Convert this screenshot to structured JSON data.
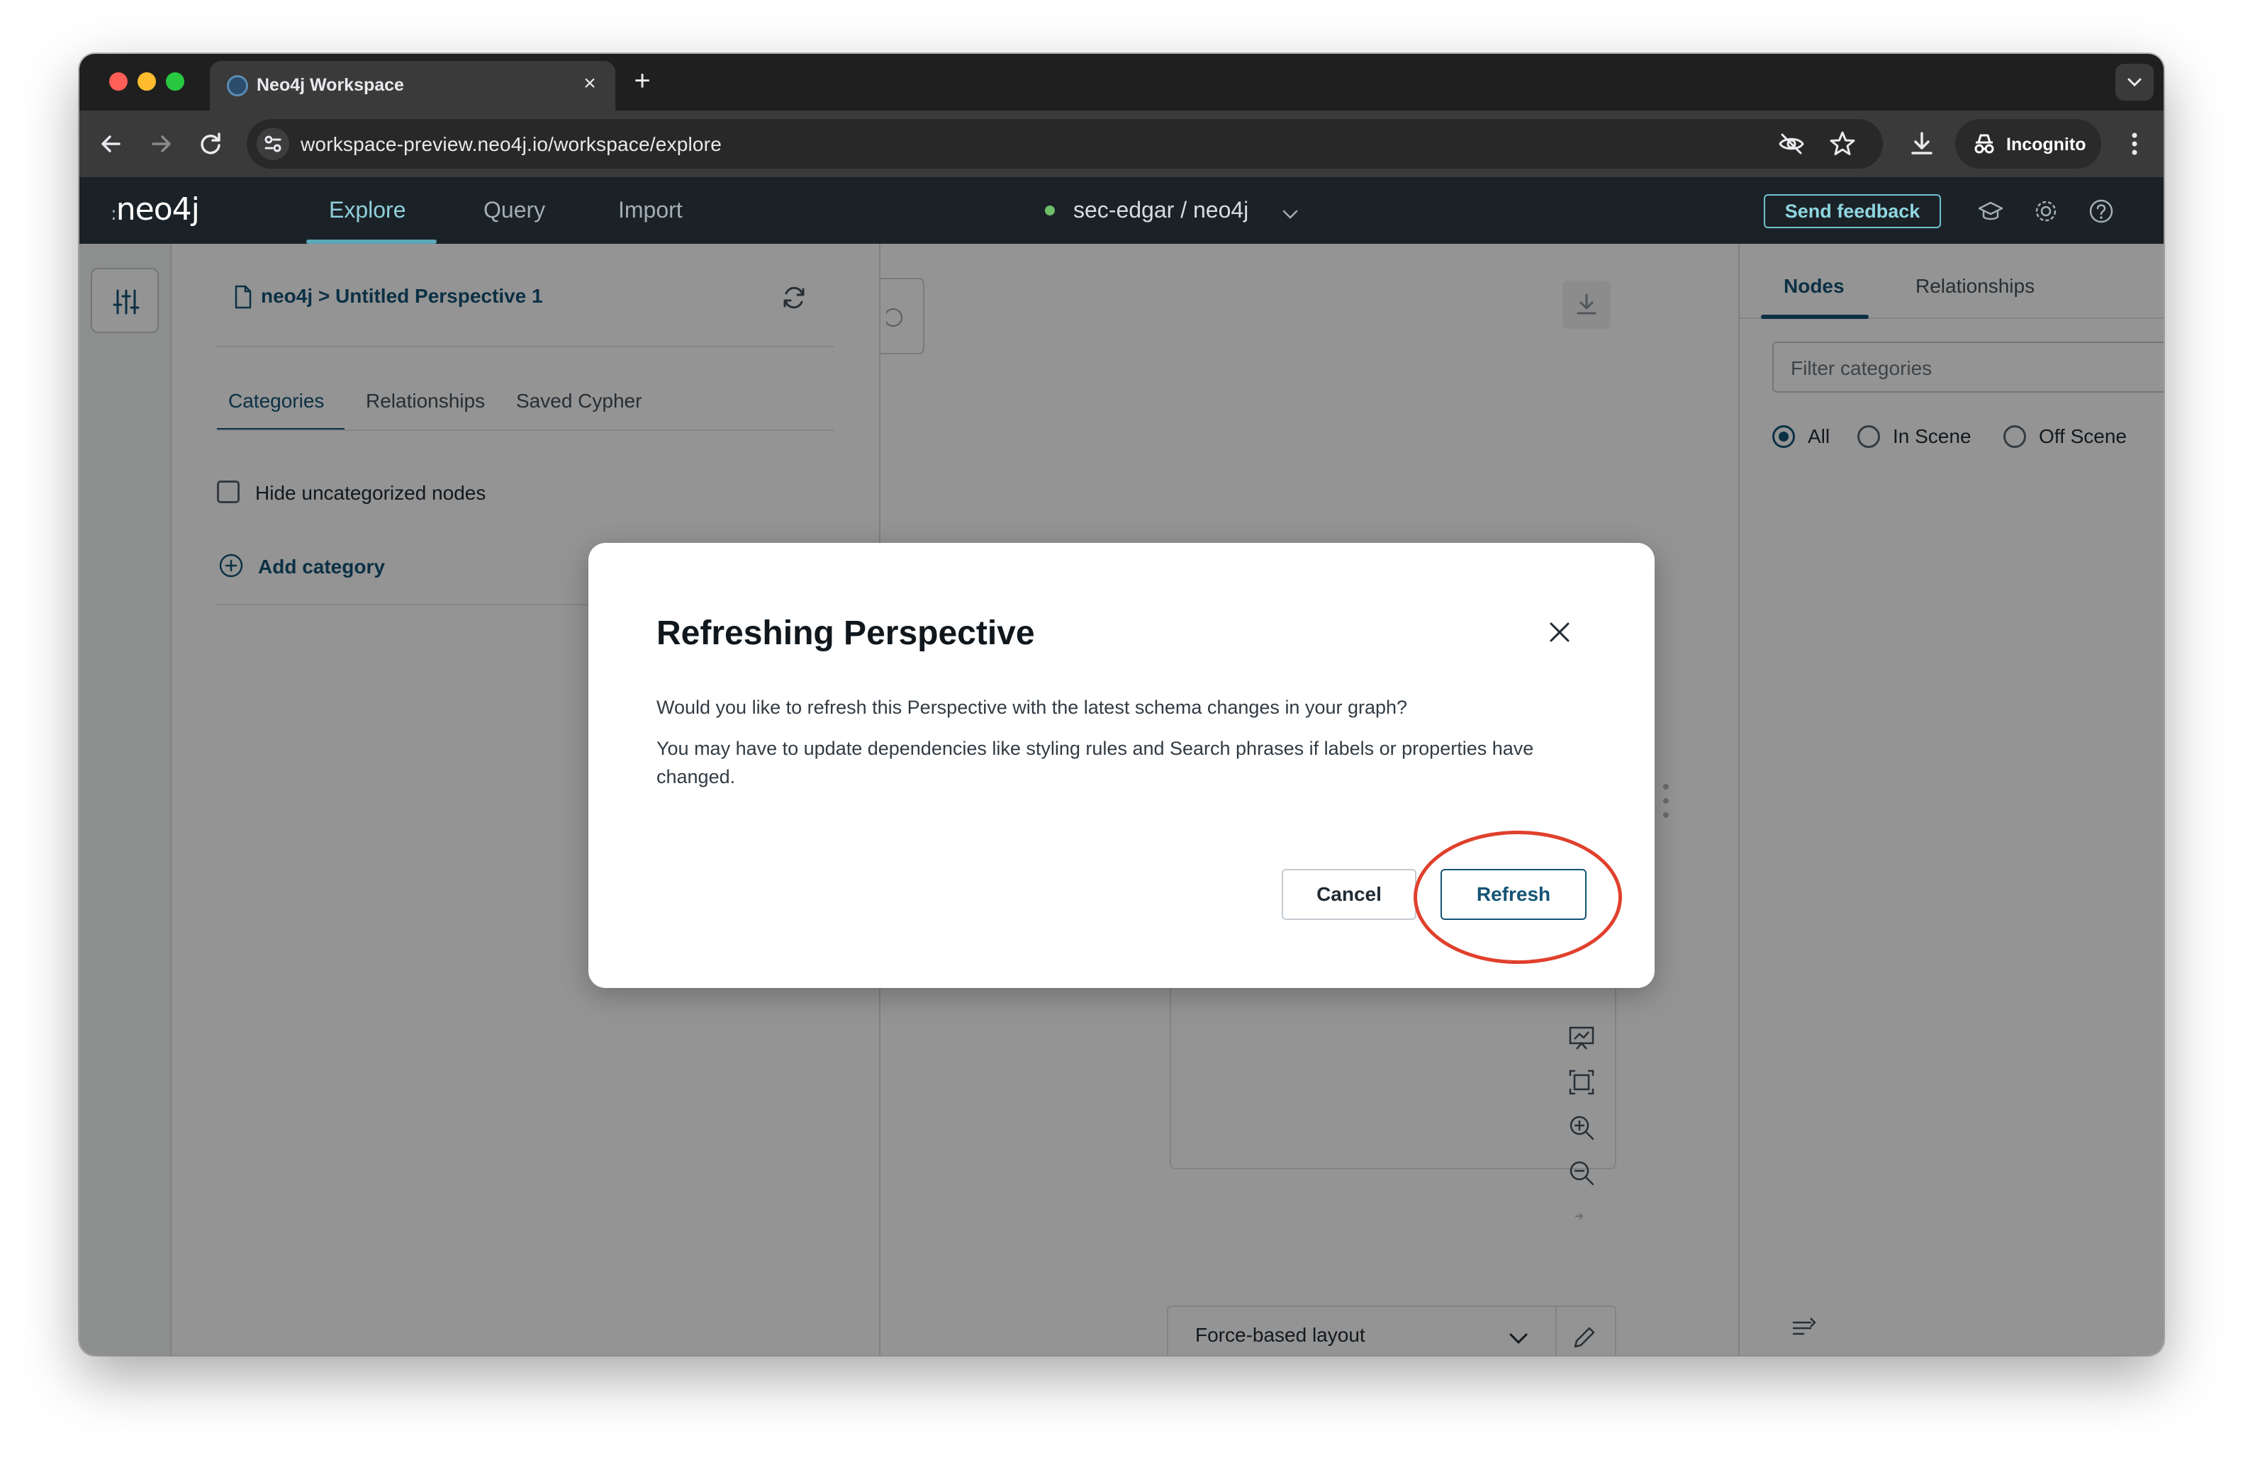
{
  "browser": {
    "tab_title": "Neo4j Workspace",
    "new_tab_symbol": "+",
    "close_symbol": "×",
    "url": "workspace-preview.neo4j.io/workspace/explore",
    "incognito_label": "Incognito"
  },
  "app": {
    "logo_text": "neo4j",
    "tabs": [
      {
        "label": "Explore",
        "active": true
      },
      {
        "label": "Query",
        "active": false
      },
      {
        "label": "Import",
        "active": false
      }
    ],
    "database": "sec-edgar / neo4j",
    "db_status_color": "#6fbe6a",
    "feedback_label": "Send feedback",
    "accent": "#145475"
  },
  "drawer": {
    "breadcrumb": "neo4j > Untitled Perspective 1",
    "tabs": [
      {
        "label": "Categories",
        "active": true
      },
      {
        "label": "Relationships",
        "active": false
      },
      {
        "label": "Saved Cypher",
        "active": false
      }
    ],
    "hide_uncategorized_label": "Hide uncategorized nodes",
    "hide_uncategorized_checked": false,
    "add_category_label": "Add category"
  },
  "canvas": {
    "layout_label": "Force-based layout"
  },
  "right_panel": {
    "tabs": [
      {
        "label": "Nodes",
        "active": true
      },
      {
        "label": "Relationships",
        "active": false
      }
    ],
    "filter_placeholder": "Filter categories",
    "scope_options": [
      {
        "label": "All",
        "selected": true
      },
      {
        "label": "In Scene",
        "selected": false
      },
      {
        "label": "Off Scene",
        "selected": false
      }
    ]
  },
  "modal": {
    "title": "Refreshing Perspective",
    "line1": "Would you like to refresh this Perspective with the latest schema changes in your graph?",
    "line2": "You may have to update dependencies like styling rules and Search phrases if labels or properties have changed.",
    "cancel_label": "Cancel",
    "refresh_label": "Refresh",
    "annotation_color": "#e0402c"
  }
}
